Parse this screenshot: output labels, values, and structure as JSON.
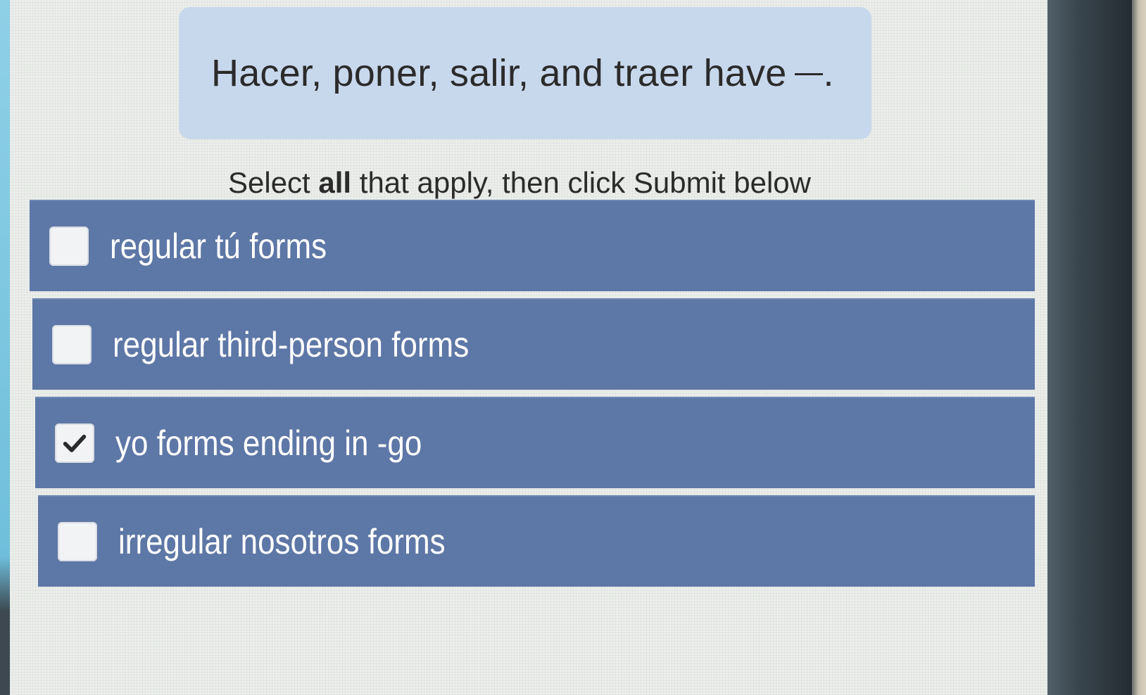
{
  "question": {
    "text": "Hacer, poner, salir, and traer have",
    "end_punct": "."
  },
  "instruction": {
    "prefix": "Select ",
    "emphasis": "all",
    "suffix": " that apply, then click Submit below"
  },
  "options": [
    {
      "label": "regular tú forms",
      "checked": false
    },
    {
      "label": "regular third-person forms",
      "checked": false
    },
    {
      "label": "yo forms ending in -go",
      "checked": true
    },
    {
      "label": "irregular nosotros forms",
      "checked": false
    }
  ],
  "colors": {
    "option_bg": "#5d77a6",
    "question_bg": "#c8d8ec",
    "checkbox_bg": "#f1f3f5",
    "check_mark": "#2b2b2b"
  },
  "icons": {
    "check": "checkmark-icon"
  }
}
